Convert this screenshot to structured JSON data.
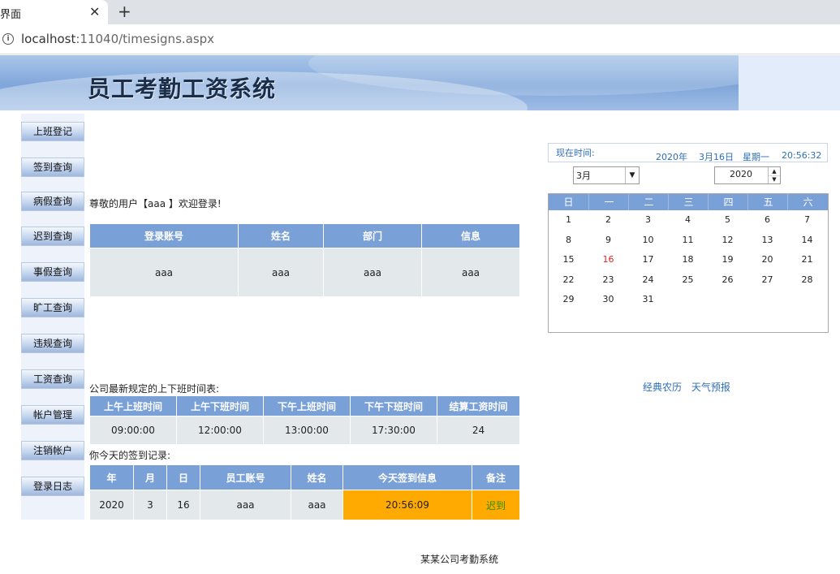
{
  "browser": {
    "tab_title": "界面",
    "close_symbol": "✕",
    "new_tab_symbol": "+",
    "url_host": "localhost",
    "url_rest": ":11040/timesigns.aspx"
  },
  "banner": {
    "title": "员工考勤工资系统"
  },
  "sidebar": {
    "items": [
      "上班登记",
      "签到查询",
      "病假查询",
      "迟到查询",
      "事假查询",
      "旷工查询",
      "违规查询",
      "工资查询",
      "帐户管理",
      "注销帐户",
      "登录日志"
    ]
  },
  "greeting": "尊敬的用户【aaa 】欢迎登录!",
  "user_table": {
    "headers": [
      "登录账号",
      "姓名",
      "部门",
      "信息"
    ],
    "row": [
      "aaa",
      "aaa",
      "aaa",
      "aaa"
    ]
  },
  "schedule": {
    "caption": "公司最新规定的上下班时间表:",
    "headers": [
      "上午上班时间",
      "上午下班时间",
      "下午上班时间",
      "下午下班时间",
      "结算工资时间"
    ],
    "row": [
      "09:00:00",
      "12:00:00",
      "13:00:00",
      "17:30:00",
      "24"
    ]
  },
  "record": {
    "caption": "你今天的签到记录:",
    "headers": [
      "年",
      "月",
      "日",
      "员工账号",
      "姓名",
      "今天签到信息",
      "备注"
    ],
    "row": [
      "2020",
      "3",
      "16",
      "aaa",
      "aaa",
      "20:56:09",
      "迟到"
    ]
  },
  "clock": {
    "label": "现在时间:",
    "year": "2020年",
    "date": "3月16日",
    "weekday": "星期一",
    "time": "20:56:32"
  },
  "calendar": {
    "month_value": "3月",
    "year_value": "2020",
    "weekdays": [
      "日",
      "一",
      "二",
      "三",
      "四",
      "五",
      "六"
    ],
    "weeks": [
      [
        "1",
        "2",
        "3",
        "4",
        "5",
        "6",
        "7"
      ],
      [
        "8",
        "9",
        "10",
        "11",
        "12",
        "13",
        "14"
      ],
      [
        "15",
        "16",
        "17",
        "18",
        "19",
        "20",
        "21"
      ],
      [
        "22",
        "23",
        "24",
        "25",
        "26",
        "27",
        "28"
      ],
      [
        "29",
        "30",
        "31",
        "",
        "",
        "",
        ""
      ]
    ],
    "today": "16",
    "today_color": "#e02020"
  },
  "links": [
    "经典农历",
    "天气预报"
  ],
  "footer": "某某公司考勤系统",
  "colors": {
    "header_blue": "#7aa0d8",
    "late_orange": "#ffaa00",
    "late_text": "#2f8f00",
    "link_blue": "#2d6fb7"
  }
}
